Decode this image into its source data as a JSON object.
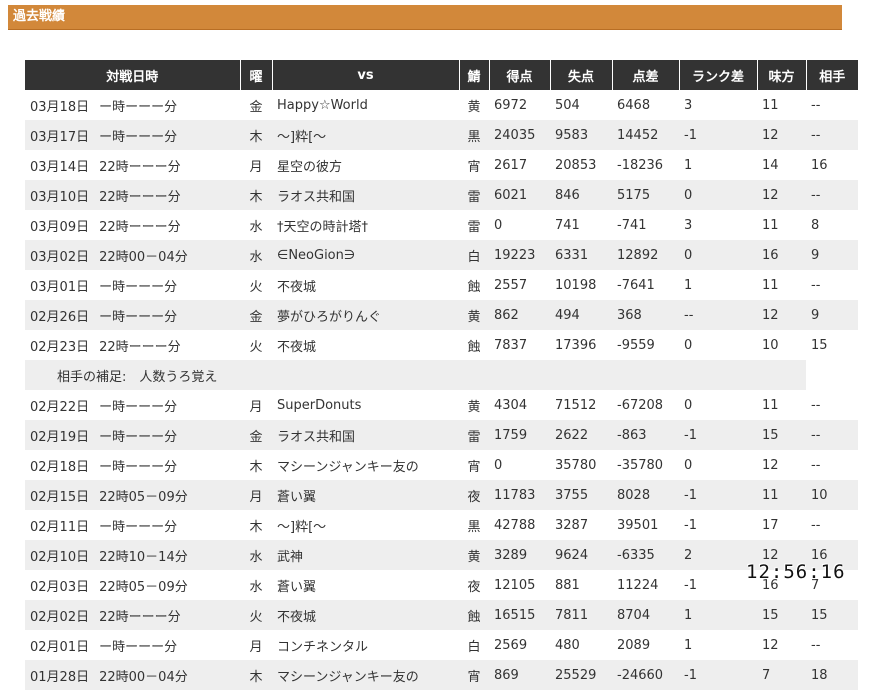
{
  "section": {
    "title": "過去戦績"
  },
  "table": {
    "headers": [
      "対戦日時",
      "曜",
      "vs",
      "鯖",
      "得点",
      "失点",
      "点差",
      "ランク差",
      "味方",
      "相手"
    ],
    "rows": [
      {
        "date": "03月18日",
        "time": "ー時ーーー分",
        "day": "金",
        "vs": "Happy☆World",
        "server": "黄",
        "score": "6972",
        "lost": "504",
        "diff": "6468",
        "rank_diff": "3",
        "ally": "11",
        "enemy": "--"
      },
      {
        "date": "03月17日",
        "time": "ー時ーーー分",
        "day": "木",
        "vs": "〜]粋[〜",
        "server": "黒",
        "score": "24035",
        "lost": "9583",
        "diff": "14452",
        "rank_diff": "-1",
        "ally": "12",
        "enemy": "--"
      },
      {
        "date": "03月14日",
        "time": "22時ーーー分",
        "day": "月",
        "vs": "星空の彼方",
        "server": "宵",
        "score": "2617",
        "lost": "20853",
        "diff": "-18236",
        "rank_diff": "1",
        "ally": "14",
        "enemy": "16"
      },
      {
        "date": "03月10日",
        "time": "22時ーーー分",
        "day": "木",
        "vs": "ラオス共和国",
        "server": "雷",
        "score": "6021",
        "lost": "846",
        "diff": "5175",
        "rank_diff": "0",
        "ally": "12",
        "enemy": "--"
      },
      {
        "date": "03月09日",
        "time": "22時ーーー分",
        "day": "水",
        "vs": "†天空の時計塔†",
        "server": "雷",
        "score": "0",
        "lost": "741",
        "diff": "-741",
        "rank_diff": "3",
        "ally": "11",
        "enemy": "8"
      },
      {
        "date": "03月02日",
        "time": "22時00－04分",
        "day": "水",
        "vs": "∈NeoGion∋",
        "server": "白",
        "score": "19223",
        "lost": "6331",
        "diff": "12892",
        "rank_diff": "0",
        "ally": "16",
        "enemy": "9"
      },
      {
        "date": "03月01日",
        "time": "ー時ーーー分",
        "day": "火",
        "vs": "不夜城",
        "server": "蝕",
        "score": "2557",
        "lost": "10198",
        "diff": "-7641",
        "rank_diff": "1",
        "ally": "11",
        "enemy": "--"
      },
      {
        "date": "02月26日",
        "time": "ー時ーーー分",
        "day": "金",
        "vs": "夢がひろがりんぐ",
        "server": "黄",
        "score": "862",
        "lost": "494",
        "diff": "368",
        "rank_diff": "--",
        "ally": "12",
        "enemy": "9"
      },
      {
        "date": "02月23日",
        "time": "22時ーーー分",
        "day": "火",
        "vs": "不夜城",
        "server": "蝕",
        "score": "7837",
        "lost": "17396",
        "diff": "-9559",
        "rank_diff": "0",
        "ally": "10",
        "enemy": "15"
      }
    ],
    "note": "相手の補足:　人数うろ覚え",
    "rows_after_note": [
      {
        "date": "02月22日",
        "time": "ー時ーーー分",
        "day": "月",
        "vs": "SuperDonuts",
        "server": "黄",
        "score": "4304",
        "lost": "71512",
        "diff": "-67208",
        "rank_diff": "0",
        "ally": "11",
        "enemy": "--"
      },
      {
        "date": "02月19日",
        "time": "ー時ーーー分",
        "day": "金",
        "vs": "ラオス共和国",
        "server": "雷",
        "score": "1759",
        "lost": "2622",
        "diff": "-863",
        "rank_diff": "-1",
        "ally": "15",
        "enemy": "--"
      },
      {
        "date": "02月18日",
        "time": "ー時ーーー分",
        "day": "木",
        "vs": "マシーンジャンキー友の",
        "server": "宵",
        "score": "0",
        "lost": "35780",
        "diff": "-35780",
        "rank_diff": "0",
        "ally": "12",
        "enemy": "--"
      },
      {
        "date": "02月15日",
        "time": "22時05－09分",
        "day": "月",
        "vs": "蒼い翼",
        "server": "夜",
        "score": "11783",
        "lost": "3755",
        "diff": "8028",
        "rank_diff": "-1",
        "ally": "11",
        "enemy": "10"
      },
      {
        "date": "02月11日",
        "time": "ー時ーーー分",
        "day": "木",
        "vs": "〜]粋[〜",
        "server": "黒",
        "score": "42788",
        "lost": "3287",
        "diff": "39501",
        "rank_diff": "-1",
        "ally": "17",
        "enemy": "--"
      },
      {
        "date": "02月10日",
        "time": "22時10－14分",
        "day": "水",
        "vs": "武神",
        "server": "黄",
        "score": "3289",
        "lost": "9624",
        "diff": "-6335",
        "rank_diff": "2",
        "ally": "12",
        "enemy": "16"
      },
      {
        "date": "02月03日",
        "time": "22時05－09分",
        "day": "水",
        "vs": "蒼い翼",
        "server": "夜",
        "score": "12105",
        "lost": "881",
        "diff": "11224",
        "rank_diff": "-1",
        "ally": "16",
        "enemy": "7"
      },
      {
        "date": "02月02日",
        "time": "22時ーーー分",
        "day": "火",
        "vs": "不夜城",
        "server": "蝕",
        "score": "16515",
        "lost": "7811",
        "diff": "8704",
        "rank_diff": "1",
        "ally": "15",
        "enemy": "15"
      },
      {
        "date": "02月01日",
        "time": "ー時ーーー分",
        "day": "月",
        "vs": "コンチネンタル",
        "server": "白",
        "score": "2569",
        "lost": "480",
        "diff": "2089",
        "rank_diff": "1",
        "ally": "12",
        "enemy": "--"
      },
      {
        "date": "01月28日",
        "time": "22時00－04分",
        "day": "木",
        "vs": "マシーンジャンキー友の",
        "server": "宵",
        "score": "869",
        "lost": "25529",
        "diff": "-24660",
        "rank_diff": "-1",
        "ally": "7",
        "enemy": "18"
      }
    ]
  },
  "overlay_clock": "12:56:16"
}
